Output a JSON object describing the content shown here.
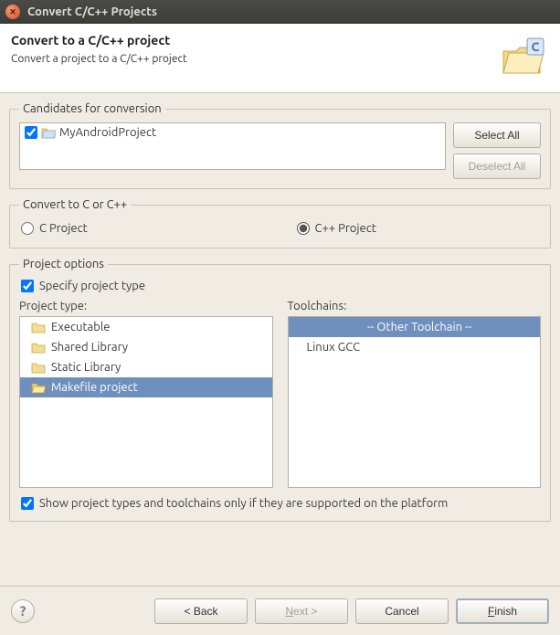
{
  "window": {
    "title": "Convert C/C++ Projects"
  },
  "header": {
    "title": "Convert to a C/C++ project",
    "subtitle": "Convert a project to a C/C++ project"
  },
  "candidates": {
    "legend": "Candidates for conversion",
    "items": [
      {
        "name": "MyAndroidProject",
        "checked": true
      }
    ],
    "select_all": "Select All",
    "deselect_all": "Deselect All"
  },
  "convert": {
    "legend": "Convert to C or C++",
    "c_label": "C Project",
    "cpp_label": "C++ Project",
    "selected": "cpp"
  },
  "options": {
    "legend": "Project options",
    "specify_label": "Specify project type",
    "specify_checked": true,
    "project_type_label": "Project type:",
    "toolchains_label": "Toolchains:",
    "project_types": [
      {
        "label": "Executable",
        "selected": false
      },
      {
        "label": "Shared Library",
        "selected": false
      },
      {
        "label": "Static Library",
        "selected": false
      },
      {
        "label": "Makefile project",
        "selected": true
      }
    ],
    "toolchains": [
      {
        "label": "-- Other Toolchain --",
        "selected": true
      },
      {
        "label": "Linux GCC",
        "selected": false
      }
    ],
    "platform_filter_label": "Show project types and toolchains only if they are supported on the platform",
    "platform_filter_checked": true
  },
  "footer": {
    "back": "< Back",
    "next": "Next >",
    "cancel": "Cancel",
    "finish": "Finish"
  }
}
